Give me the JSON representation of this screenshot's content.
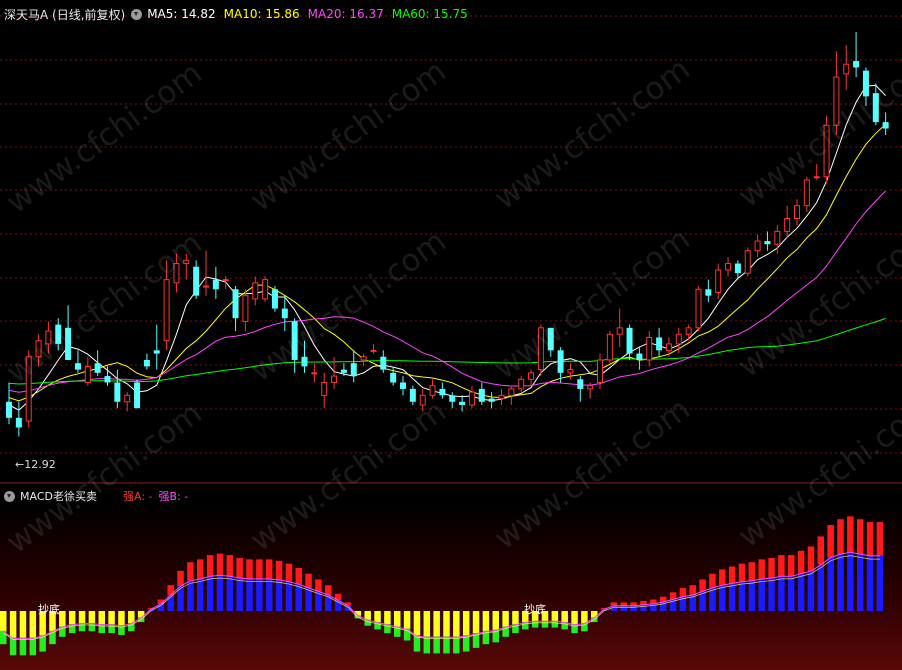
{
  "header": {
    "title": "深天马A (日线,前复权)",
    "indicators": [
      {
        "label": "MA5: 14.82",
        "color": "#ffffff"
      },
      {
        "label": "MA10: 15.86",
        "color": "#ffff00"
      },
      {
        "label": "MA20: 16.37",
        "color": "#ff44ff"
      },
      {
        "label": "MA60: 15.75",
        "color": "#00ff00"
      }
    ]
  },
  "low_marker": "←12.92",
  "sub_header": {
    "name": "MACD老徐买卖",
    "strong_a": "强A: -",
    "strong_b": "强B: -"
  },
  "bottom_labels": [
    "抄底",
    "抄底"
  ],
  "watermark": "www.cfchi.com",
  "colors": {
    "up": "#ff3232",
    "down": "#54ffff",
    "ma5": "#ffffff",
    "ma10": "#ffff00",
    "ma20": "#ff44ff",
    "ma60": "#00ff00",
    "grid": "#7a1010"
  },
  "chart_data": [
    {
      "type": "candlestick",
      "series_names": [
        "MA5",
        "MA10",
        "MA20",
        "MA60"
      ],
      "candles": [
        [
          14.0,
          14.6,
          13.3,
          13.5
        ],
        [
          13.5,
          14.0,
          12.92,
          13.2
        ],
        [
          13.4,
          15.6,
          13.2,
          15.4
        ],
        [
          15.4,
          16.1,
          15.1,
          15.9
        ],
        [
          15.8,
          16.5,
          15.5,
          16.2
        ],
        [
          16.4,
          16.6,
          15.6,
          15.8
        ],
        [
          16.3,
          17.0,
          15.3,
          15.3
        ],
        [
          15.2,
          15.6,
          14.9,
          15.0
        ],
        [
          14.6,
          15.4,
          14.5,
          15.1
        ],
        [
          15.2,
          15.6,
          14.8,
          14.9
        ],
        [
          14.8,
          15.1,
          14.5,
          14.6
        ],
        [
          14.6,
          15.0,
          13.8,
          14.0
        ],
        [
          14.0,
          14.3,
          13.7,
          14.2
        ],
        [
          14.6,
          14.7,
          13.8,
          13.8
        ],
        [
          15.3,
          15.5,
          15.0,
          15.1
        ],
        [
          15.6,
          16.4,
          15.0,
          15.5
        ],
        [
          15.9,
          18.4,
          15.6,
          17.8
        ],
        [
          17.7,
          18.6,
          17.4,
          18.3
        ],
        [
          18.3,
          18.6,
          17.8,
          18.4
        ],
        [
          18.2,
          18.4,
          17.2,
          17.3
        ],
        [
          17.6,
          18.7,
          17.3,
          17.6
        ],
        [
          17.8,
          18.2,
          17.2,
          17.5
        ],
        [
          17.8,
          17.9,
          17.5,
          17.8
        ],
        [
          17.5,
          17.6,
          16.2,
          16.6
        ],
        [
          16.5,
          17.5,
          16.2,
          17.3
        ],
        [
          17.2,
          17.9,
          17.0,
          17.7
        ],
        [
          17.2,
          17.9,
          17.1,
          17.8
        ],
        [
          17.5,
          17.6,
          16.8,
          16.9
        ],
        [
          16.9,
          17.3,
          16.2,
          16.6
        ],
        [
          16.5,
          16.6,
          14.9,
          15.3
        ],
        [
          15.4,
          15.9,
          14.9,
          15.1
        ],
        [
          14.9,
          15.2,
          14.6,
          14.9
        ],
        [
          14.2,
          14.9,
          13.8,
          14.6
        ],
        [
          14.6,
          15.4,
          14.4,
          14.8
        ],
        [
          15.0,
          15.2,
          14.8,
          14.9
        ],
        [
          15.2,
          15.6,
          14.6,
          14.8
        ],
        [
          15.3,
          15.5,
          15.1,
          15.4
        ],
        [
          15.6,
          15.8,
          15.5,
          15.6
        ],
        [
          15.4,
          15.6,
          14.9,
          15.0
        ],
        [
          14.9,
          15.1,
          14.5,
          14.6
        ],
        [
          14.6,
          14.8,
          14.2,
          14.4
        ],
        [
          14.4,
          14.5,
          13.9,
          14.0
        ],
        [
          13.9,
          14.4,
          13.7,
          14.2
        ],
        [
          14.2,
          14.7,
          14.1,
          14.5
        ],
        [
          14.4,
          14.6,
          14.1,
          14.2
        ],
        [
          14.2,
          14.3,
          13.8,
          14.0
        ],
        [
          14.0,
          14.2,
          13.7,
          13.9
        ],
        [
          13.9,
          14.5,
          13.8,
          14.3
        ],
        [
          14.4,
          14.6,
          13.9,
          14.0
        ],
        [
          14.1,
          14.3,
          13.8,
          14.0
        ],
        [
          14.1,
          14.4,
          13.9,
          14.2
        ],
        [
          14.2,
          14.5,
          13.9,
          14.4
        ],
        [
          14.4,
          14.8,
          14.3,
          14.7
        ],
        [
          14.7,
          15.0,
          14.5,
          14.9
        ],
        [
          15.0,
          16.4,
          14.8,
          16.3
        ],
        [
          16.3,
          16.3,
          15.4,
          15.6
        ],
        [
          15.6,
          15.7,
          14.6,
          14.9
        ],
        [
          14.9,
          15.2,
          14.7,
          15.0
        ],
        [
          14.7,
          14.8,
          14.0,
          14.4
        ],
        [
          14.4,
          14.6,
          14.1,
          14.5
        ],
        [
          14.6,
          15.5,
          14.4,
          15.3
        ],
        [
          15.3,
          16.2,
          15.2,
          16.1
        ],
        [
          16.1,
          16.9,
          15.7,
          16.3
        ],
        [
          16.3,
          16.4,
          15.3,
          15.5
        ],
        [
          15.5,
          15.7,
          15.0,
          15.3
        ],
        [
          15.3,
          16.2,
          15.1,
          16.0
        ],
        [
          16.0,
          16.3,
          15.4,
          15.6
        ],
        [
          15.6,
          16.0,
          15.4,
          15.8
        ],
        [
          15.8,
          16.3,
          15.5,
          16.1
        ],
        [
          16.1,
          16.4,
          15.9,
          16.3
        ],
        [
          16.3,
          17.6,
          16.2,
          17.5
        ],
        [
          17.5,
          17.8,
          17.1,
          17.3
        ],
        [
          17.4,
          18.3,
          17.2,
          18.1
        ],
        [
          18.1,
          18.5,
          17.9,
          18.3
        ],
        [
          18.3,
          18.4,
          17.8,
          18.0
        ],
        [
          18.0,
          18.8,
          17.9,
          18.7
        ],
        [
          18.7,
          19.2,
          18.5,
          19.0
        ],
        [
          19.0,
          19.3,
          18.7,
          18.9
        ],
        [
          18.9,
          19.5,
          18.6,
          19.3
        ],
        [
          19.3,
          20.1,
          19.1,
          19.7
        ],
        [
          19.7,
          20.3,
          19.5,
          20.1
        ],
        [
          20.1,
          21.0,
          19.9,
          20.9
        ],
        [
          21.0,
          21.4,
          20.9,
          21.0
        ],
        [
          21.0,
          22.9,
          20.8,
          22.6
        ],
        [
          22.6,
          24.9,
          22.3,
          24.1
        ],
        [
          24.2,
          25.1,
          23.7,
          24.5
        ],
        [
          24.6,
          25.5,
          24.1,
          24.4
        ],
        [
          24.3,
          24.4,
          23.2,
          23.5
        ],
        [
          23.6,
          23.9,
          22.6,
          22.7
        ],
        [
          22.7,
          23.0,
          22.3,
          22.5
        ]
      ]
    },
    {
      "type": "bar",
      "name": "MACD老徐买卖",
      "values": [
        -0.9,
        -1.2,
        -1.2,
        -1.2,
        -1.1,
        -0.9,
        -0.7,
        -0.6,
        -0.55,
        -0.55,
        -0.6,
        -0.6,
        -0.65,
        -0.55,
        -0.3,
        0.1,
        0.4,
        0.9,
        1.4,
        1.7,
        1.8,
        1.95,
        2.0,
        1.95,
        1.85,
        1.8,
        1.8,
        1.8,
        1.75,
        1.65,
        1.5,
        1.3,
        1.1,
        0.9,
        0.6,
        0.3,
        -0.2,
        -0.4,
        -0.5,
        -0.6,
        -0.7,
        -0.8,
        -1.1,
        -1.15,
        -1.15,
        -1.15,
        -1.15,
        -1.1,
        -1.0,
        -0.9,
        -0.85,
        -0.7,
        -0.6,
        -0.5,
        -0.45,
        -0.45,
        -0.45,
        -0.5,
        -0.6,
        -0.55,
        -0.3,
        0.1,
        0.3,
        0.3,
        0.3,
        0.35,
        0.4,
        0.5,
        0.65,
        0.8,
        0.9,
        1.1,
        1.3,
        1.45,
        1.55,
        1.65,
        1.7,
        1.8,
        1.85,
        1.95,
        1.95,
        2.1,
        2.25,
        2.6,
        3.0,
        3.2,
        3.3,
        3.2,
        3.1,
        3.1
      ],
      "ylim": [
        -1.6,
        3.8
      ]
    }
  ]
}
